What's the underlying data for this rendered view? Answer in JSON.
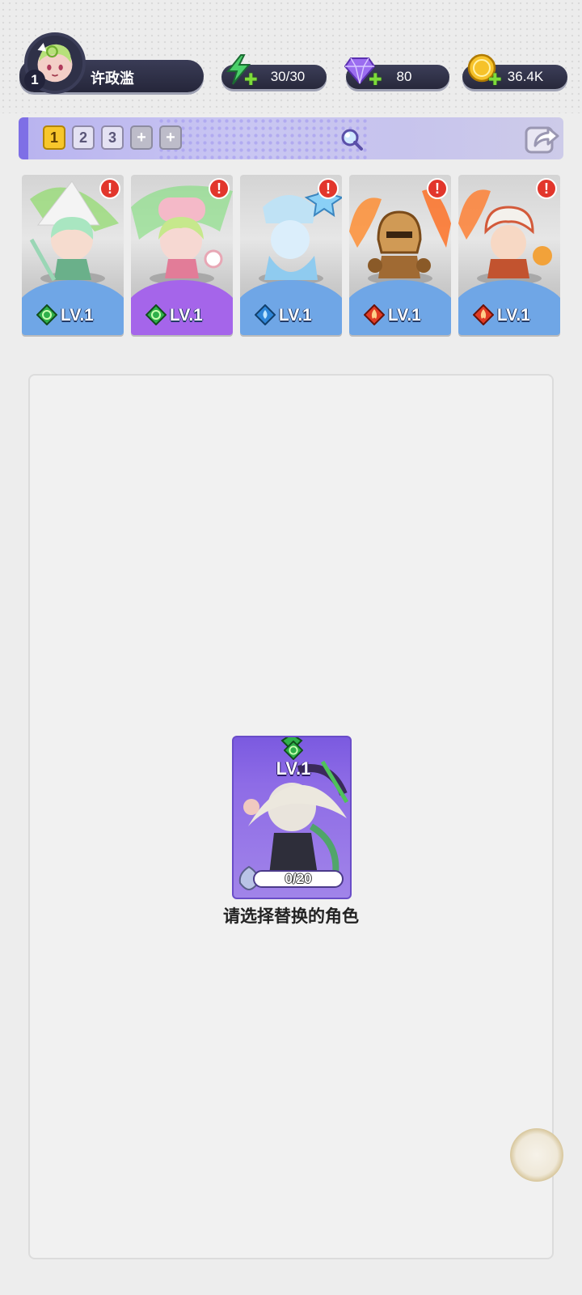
{
  "player": {
    "name": "许政滥",
    "level": "1"
  },
  "resources": {
    "energy": "30/30",
    "gems": "80",
    "coins": "36.4K"
  },
  "team_tabs": [
    "1",
    "2",
    "3",
    "+",
    "+"
  ],
  "active_team_tab": "1",
  "characters": [
    {
      "level_label": "LV.1",
      "element": "wind",
      "alert": "!"
    },
    {
      "level_label": "LV.1",
      "element": "wind",
      "alert": "!"
    },
    {
      "level_label": "LV.1",
      "element": "water",
      "alert": "!"
    },
    {
      "level_label": "LV.1",
      "element": "fire",
      "alert": "!"
    },
    {
      "level_label": "LV.1",
      "element": "fire",
      "alert": "!"
    }
  ],
  "selected_card": {
    "level_label": "LV.1",
    "shards": "0/20",
    "shard_progress": 0
  },
  "select_prompt": "请选择替换的角色",
  "colors": {
    "accent_purple": "#7e6fe6",
    "tab_active": "#f7c62b",
    "card_foot_blue": "#69a2e4",
    "card_foot_purple": "#9e5ce8",
    "alert_red": "#e2362c"
  }
}
